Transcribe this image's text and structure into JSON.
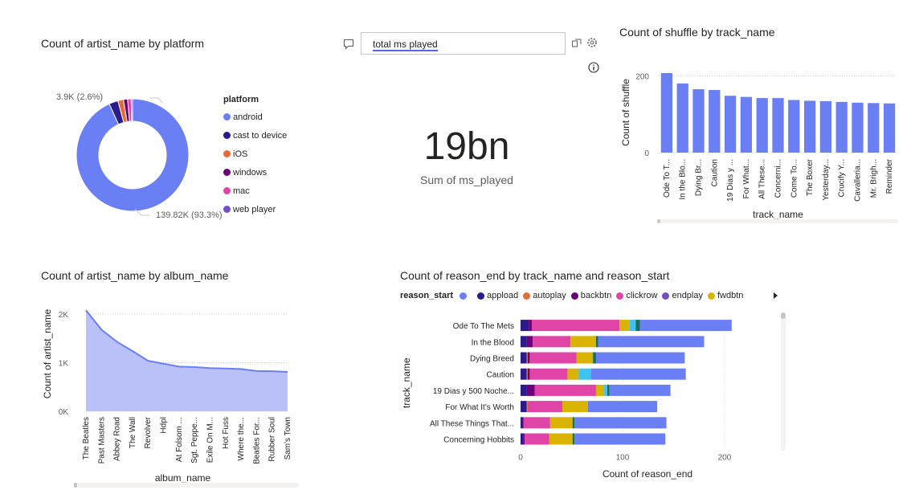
{
  "donut": {
    "title": "Count of artist_name by platform",
    "legend_title": "platform",
    "label_small": "3.9K (2.6%)",
    "label_large": "139.82K (93.3%)"
  },
  "qa": {
    "input_text": "total ms played"
  },
  "card": {
    "value": "19bn",
    "label": "Sum of ms_played"
  },
  "shuffle": {
    "title": "Count of shuffle by track_name"
  },
  "album": {
    "title": "Count of artist_name by album_name"
  },
  "reason": {
    "title": "Count of reason_end by track_name and reason_start",
    "legend_title": "reason_start"
  },
  "chart_data": [
    {
      "type": "pie",
      "title": "Count of artist_name by platform",
      "legend_title": "platform",
      "categories": [
        "android",
        "cast to device",
        "iOS",
        "windows",
        "mac",
        "web player"
      ],
      "values": [
        139820,
        3900,
        2400,
        1800,
        1500,
        600
      ],
      "colors": [
        "#6b7ff5",
        "#2a1a8a",
        "#e66c37",
        "#6b007b",
        "#e044a7",
        "#744ec2"
      ],
      "data_labels": [
        "139.82K (93.3%)",
        "3.9K (2.6%)"
      ]
    },
    {
      "type": "bar",
      "title": "Count of shuffle by track_name",
      "xlabel": "track_name",
      "ylabel": "Count of shuffle",
      "categories": [
        "Ode To T...",
        "In the Blo...",
        "Dying Br...",
        "Caution",
        "19 Dias y ...",
        "For What...",
        "All These...",
        "Concerni...",
        "Come To...",
        "The Boxer",
        "Yesterday...",
        "Crucify Y...",
        "Cavalleria...",
        "Mr. Brigh...",
        "Reminder"
      ],
      "values": [
        207,
        180,
        165,
        163,
        148,
        145,
        142,
        142,
        137,
        135,
        134,
        132,
        130,
        129,
        128
      ],
      "yticks": [
        0,
        200
      ],
      "ylim": [
        0,
        230
      ],
      "color": "#6b7ff5"
    },
    {
      "type": "area",
      "title": "Count of artist_name by album_name",
      "xlabel": "album_name",
      "ylabel": "Count of artist_name",
      "categories": [
        "The Beatles",
        "Past Masters",
        "Abbey Road",
        "The Wall",
        "Revolver",
        "Hdpl",
        "At Folsom ...",
        "Sgt. Peppe...",
        "Exile On M...",
        "Hot Fuss",
        "Where the...",
        "Beatles For...",
        "Rubber Soul",
        "Sam's Town"
      ],
      "values": [
        2080,
        1680,
        1430,
        1240,
        1040,
        980,
        920,
        910,
        890,
        880,
        870,
        830,
        825,
        810
      ],
      "yticks": [
        "0K",
        "1K",
        "2K"
      ],
      "ylim": [
        0,
        2200
      ],
      "color": "#6b7ff5"
    },
    {
      "type": "bar",
      "orientation": "horizontal",
      "stacked": true,
      "title": "Count of reason_end by track_name and reason_start",
      "xlabel": "Count of reason_end",
      "ylabel": "track_name",
      "legend_title": "reason_start",
      "categories": [
        "Ode To The Mets",
        "In the Blood",
        "Dying Breed",
        "Caution",
        "19 Dias y 500 Noche...",
        "For What It's Worth",
        "All These Things That...",
        "Concerning Hobbits"
      ],
      "xticks": [
        0,
        100,
        200
      ],
      "xlim": [
        0,
        230
      ],
      "series": [
        {
          "name": "",
          "color": "#6b7ff5",
          "values": [
            90,
            104,
            87,
            93,
            60,
            68,
            90,
            89
          ]
        },
        {
          "name": "appload",
          "color": "#2a1a8a",
          "values": [
            8,
            6,
            6,
            6,
            6,
            6,
            2,
            3
          ]
        },
        {
          "name": "autoplay",
          "color": "#e66c37",
          "values": [
            0,
            0,
            1,
            1,
            0,
            1,
            0,
            0
          ]
        },
        {
          "name": "backbtn",
          "color": "#6b007b",
          "values": [
            3,
            6,
            2,
            2,
            8,
            0,
            1,
            1
          ]
        },
        {
          "name": "clickrow",
          "color": "#e044a7",
          "values": [
            86,
            37,
            46,
            37,
            60,
            34,
            26,
            24
          ]
        },
        {
          "name": "endplay",
          "color": "#744ec2",
          "values": [
            0,
            0,
            0,
            0,
            0,
            0,
            0,
            0
          ]
        },
        {
          "name": "fwdbtn",
          "color": "#d9b300",
          "values": [
            10,
            25,
            16,
            11,
            8,
            25,
            22,
            23
          ]
        },
        {
          "name": "",
          "color": "#41c1f0",
          "values": [
            6,
            0,
            0,
            12,
            3,
            0,
            0,
            0
          ]
        },
        {
          "name": "",
          "color": "#1a6e5c",
          "values": [
            4,
            2,
            3,
            0,
            2,
            0,
            2,
            2
          ]
        }
      ]
    }
  ]
}
